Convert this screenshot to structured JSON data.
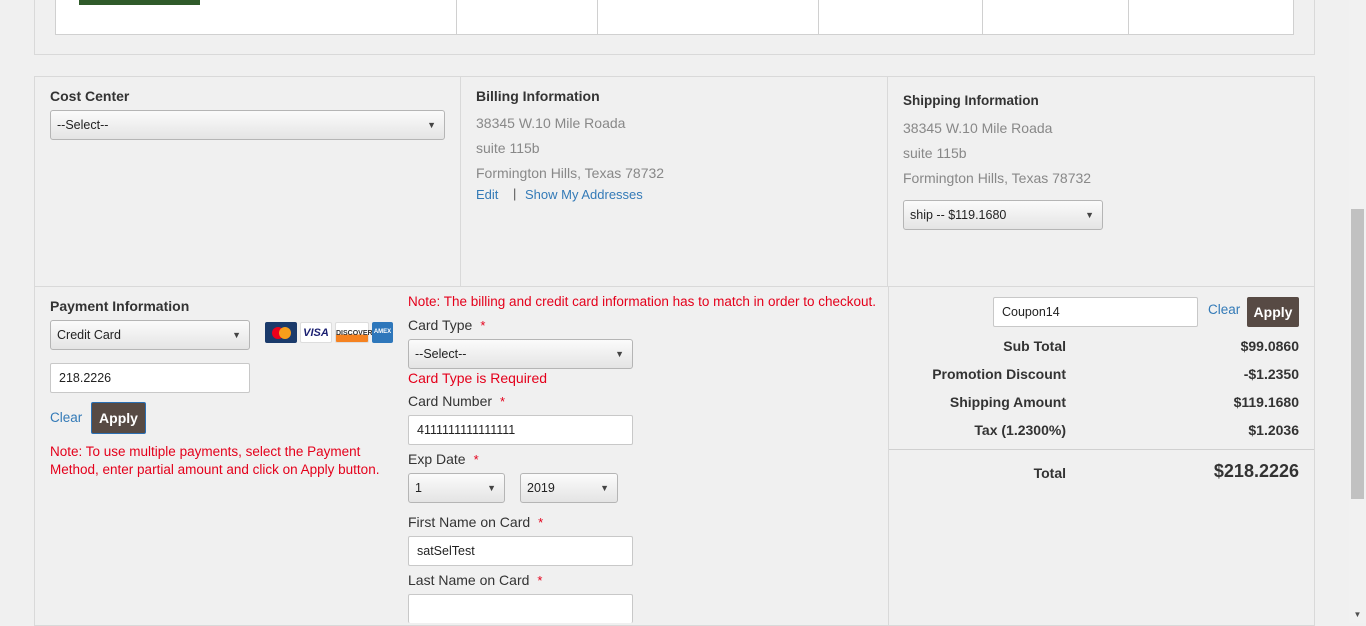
{
  "cost_center": {
    "heading": "Cost Center",
    "select_value": "--Select--"
  },
  "billing": {
    "heading": "Billing Information",
    "line1": "38345 W.10 Mile Roada",
    "line2": "suite 115b",
    "line3": "Formington Hills, Texas 78732",
    "edit_label": "Edit",
    "separator": "|",
    "show_addresses_label": "Show My Addresses"
  },
  "shipping": {
    "heading": "Shipping Information",
    "line1": "38345 W.10 Mile Roada",
    "line2": "suite 115b",
    "line3": "Formington Hills, Texas 78732",
    "method_value": "ship -- $119.1680"
  },
  "payment": {
    "heading": "Payment Information",
    "method_value": "Credit Card",
    "amount_value": "218.2226",
    "clear_label": "Clear",
    "apply_label": "Apply",
    "note": "Note: To use multiple payments, select the Payment Method, enter partial amount and click on Apply button.",
    "cards": [
      "MasterCard",
      "VISA",
      "DISCOVER",
      "AMEX"
    ]
  },
  "card_form": {
    "match_note": "Note: The billing and credit card information has to match in order to checkout.",
    "card_type_label": "Card Type",
    "required_mark": "*",
    "card_type_value": "--Select--",
    "card_type_error": "Card Type is Required",
    "card_number_label": "Card Number",
    "card_number_value": "4111111111111111",
    "exp_date_label": "Exp Date",
    "exp_month_value": "1",
    "exp_year_value": "2019",
    "first_name_label": "First Name on Card",
    "first_name_value": "satSelTest",
    "last_name_label": "Last Name on Card",
    "last_name_value": ""
  },
  "summary": {
    "coupon_value": "Coupon14",
    "clear_label": "Clear",
    "apply_label": "Apply",
    "rows": [
      {
        "label": "Sub Total",
        "value": "$99.0860"
      },
      {
        "label": "Promotion Discount",
        "value": "-$1.2350"
      },
      {
        "label": "Shipping Amount",
        "value": "$119.1680"
      },
      {
        "label": "Tax (1.2300%)",
        "value": "$1.2036"
      }
    ],
    "total_label": "Total",
    "total_value": "$218.2226"
  }
}
